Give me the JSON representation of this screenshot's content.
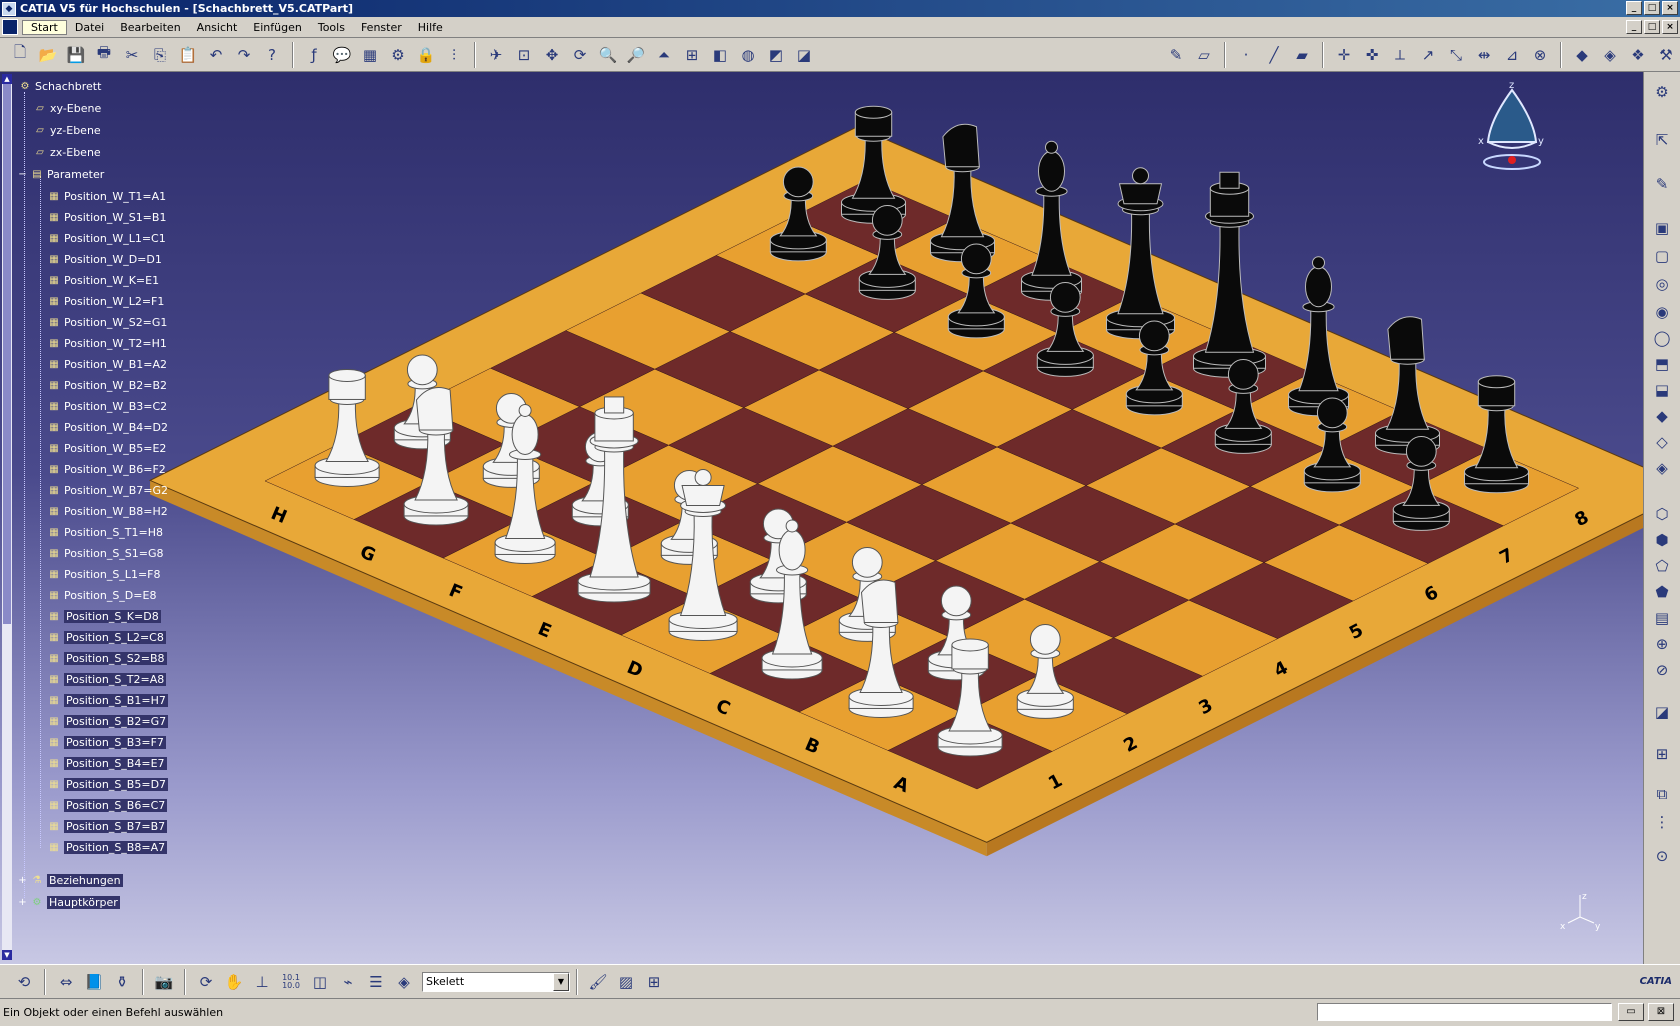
{
  "window": {
    "title": "CATIA V5 für Hochschulen - [Schachbrett_V5.CATPart]",
    "min": "_",
    "max": "□",
    "close": "×"
  },
  "menu": [
    "Start",
    "Datei",
    "Bearbeiten",
    "Ansicht",
    "Einfügen",
    "Tools",
    "Fenster",
    "Hilfe"
  ],
  "tree": {
    "root": "Schachbrett",
    "planes": [
      "xy-Ebene",
      "yz-Ebene",
      "zx-Ebene"
    ],
    "parameter_group": "Parameter",
    "parameters": [
      "Position_W_T1=A1",
      "Position_W_S1=B1",
      "Position_W_L1=C1",
      "Position_W_D=D1",
      "Position_W_K=E1",
      "Position_W_L2=F1",
      "Position_W_S2=G1",
      "Position_W_T2=H1",
      "Position_W_B1=A2",
      "Position_W_B2=B2",
      "Position_W_B3=C2",
      "Position_W_B4=D2",
      "Position_W_B5=E2",
      "Position_W_B6=F2",
      "Position_W_B7=G2",
      "Position_W_B8=H2",
      "Position_S_T1=H8",
      "Position_S_S1=G8",
      "Position_S_L1=F8",
      "Position_S_D=E8",
      "Position_S_K=D8",
      "Position_S_L2=C8",
      "Position_S_S2=B8",
      "Position_S_T2=A8",
      "Position_S_B1=H7",
      "Position_S_B2=G7",
      "Position_S_B3=F7",
      "Position_S_B4=E7",
      "Position_S_B5=D7",
      "Position_S_B6=C7",
      "Position_S_B7=B7",
      "Position_S_B8=A7"
    ],
    "relations": "Beziehungen",
    "body": "Hauptkörper"
  },
  "board": {
    "files": [
      "A",
      "B",
      "C",
      "D",
      "E",
      "F",
      "G",
      "H"
    ],
    "ranks": [
      "1",
      "2",
      "3",
      "4",
      "5",
      "6",
      "7",
      "8"
    ],
    "colors": {
      "light": "#e8a030",
      "dark": "#6e2a2a",
      "frame": "#e8a838",
      "white_piece": "#f4f4f4",
      "black_piece": "#0a0a0a"
    }
  },
  "compass": {
    "x_label": "x",
    "y_label": "y",
    "z_label": "z"
  },
  "mini_axis": {
    "x": "x",
    "y": "y",
    "z": "z"
  },
  "bottom": {
    "layer_value": "Skelett",
    "scale_top": "10.1",
    "scale_bottom": "10.0"
  },
  "status": {
    "message": "Ein Objekt oder einen Befehl auswählen"
  },
  "logo": "CATIA"
}
